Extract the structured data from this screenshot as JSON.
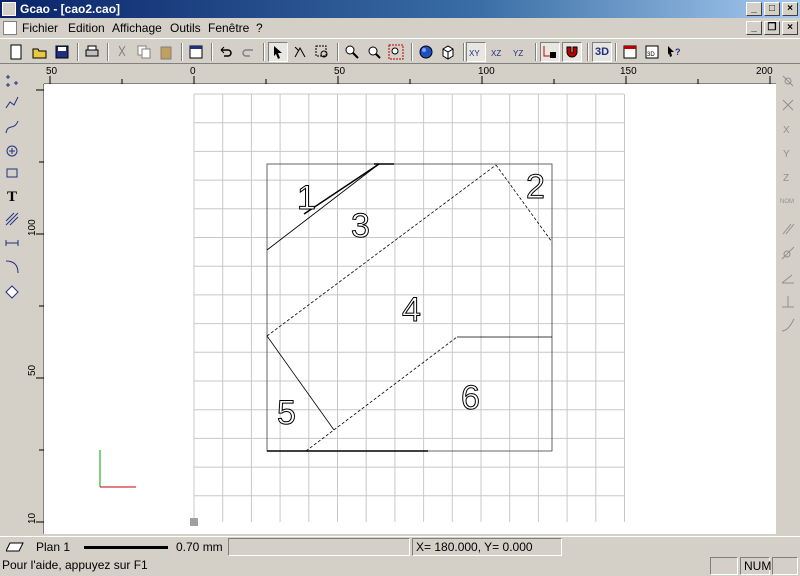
{
  "window": {
    "title": "Gcao - [cao2.cao]"
  },
  "menu": {
    "items": [
      "Fichier",
      "Edition",
      "Affichage",
      "Outils",
      "Fenêtre",
      "?"
    ]
  },
  "ruler": {
    "h_labels": [
      "50",
      "0",
      "50",
      "100",
      "150",
      "200"
    ],
    "v_labels": [
      "100",
      "50",
      "10"
    ]
  },
  "drawing": {
    "region_labels": [
      "1",
      "2",
      "3",
      "4",
      "5",
      "6"
    ]
  },
  "status": {
    "plane": "Plan 1",
    "line_width": "0.70 mm",
    "coords": "X=   180.000, Y=     0.000",
    "help": "Pour l'aide, appuyez sur F1",
    "num": "NUM"
  },
  "toolbar": {
    "mode_3d": "3D"
  }
}
